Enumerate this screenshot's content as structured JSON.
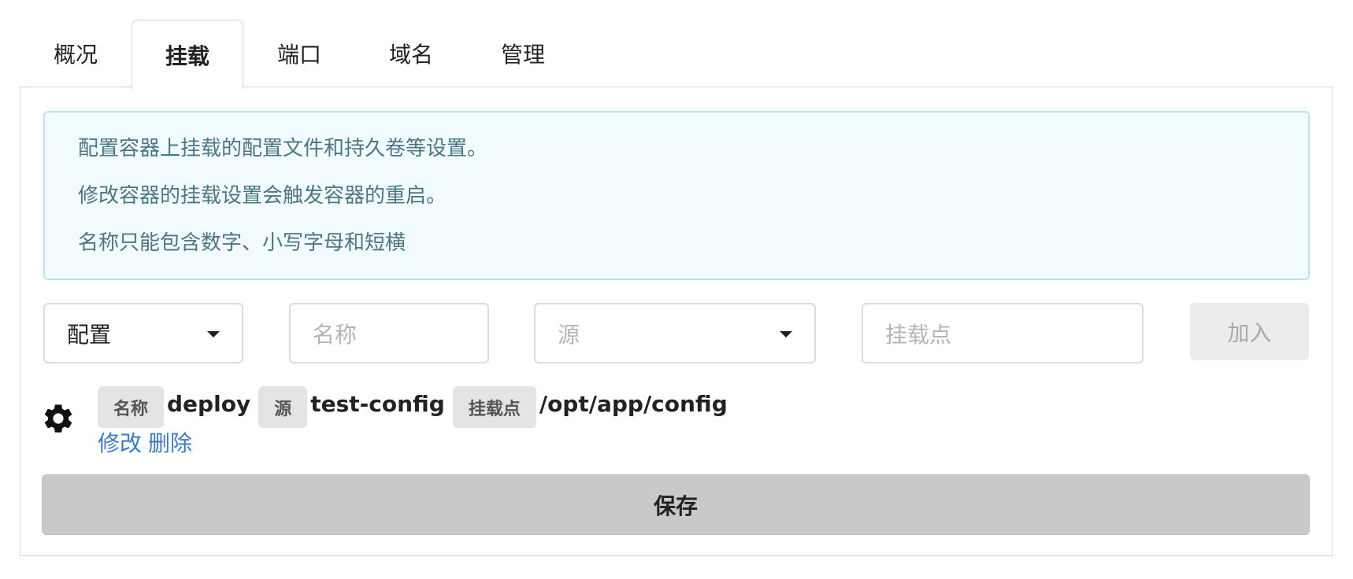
{
  "tabs": [
    {
      "label": "概况",
      "active": false
    },
    {
      "label": "挂载",
      "active": true
    },
    {
      "label": "端口",
      "active": false
    },
    {
      "label": "域名",
      "active": false
    },
    {
      "label": "管理",
      "active": false
    }
  ],
  "info": {
    "line1": "配置容器上挂载的配置文件和持久卷等设置。",
    "line2": "修改容器的挂载设置会触发容器的重启。",
    "line3": "名称只能包含数字、小写字母和短横"
  },
  "form": {
    "type_value": "配置",
    "name_placeholder": "名称",
    "source_placeholder": "源",
    "mountpoint_placeholder": "挂载点",
    "add_label": "加入"
  },
  "mount": {
    "icon": "gear-icon",
    "name_tag": "名称",
    "name_value": "deploy",
    "source_tag": "源",
    "source_value": "test-config",
    "mountpoint_tag": "挂载点",
    "mountpoint_value": "/opt/app/config",
    "edit_label": "修改",
    "delete_label": "删除"
  },
  "save_label": "保存",
  "colors": {
    "link": "#3a7bc8",
    "info_bg": "#f2fcfe",
    "info_border": "#b7e5ee",
    "info_text": "#4a7786",
    "save_bg": "#c8c9ca"
  }
}
